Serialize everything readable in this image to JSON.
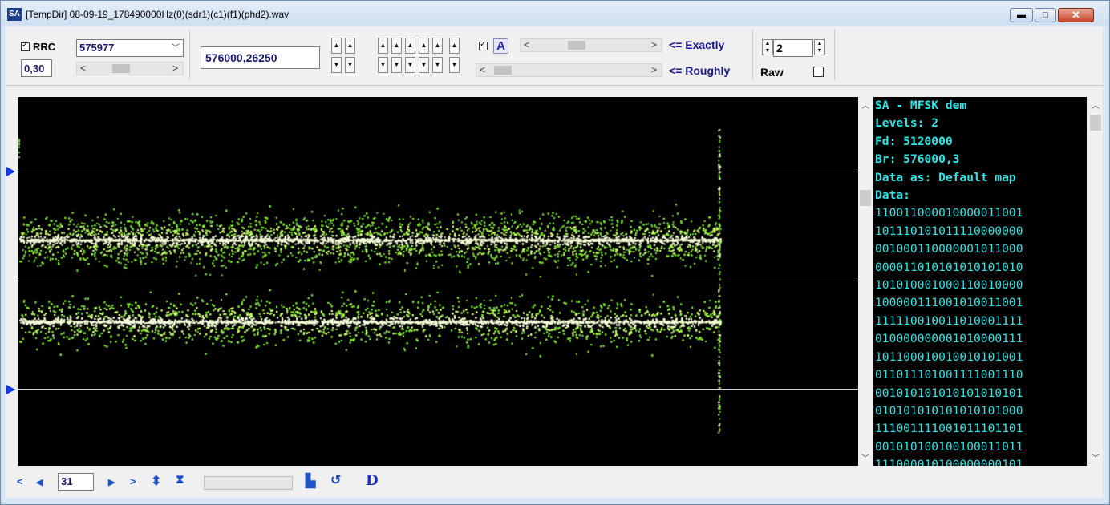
{
  "window": {
    "icon_text": "SA",
    "title": "[TempDir] 08-09-19_178490000Hz(0)(sdr1)(c1)(f1)(phd2).wav",
    "min_glyph": "▬",
    "max_glyph": "□",
    "close_glyph": "✕"
  },
  "toolbar": {
    "rrc_label": "RRC",
    "rrc_checked": true,
    "rolloff_value": "0,30",
    "rate_combo_value": "575977",
    "frequency_value": "576000,26250",
    "exactly_label": "<= Exactly",
    "roughly_label": "<= Roughly",
    "levels_value": "2",
    "raw_label": "Raw",
    "raw_checked": false,
    "auto_checked": true,
    "auto_button_label": "A",
    "scroll_left": "<",
    "scroll_right": ">",
    "spin_up": "▲",
    "spin_down": "▼"
  },
  "plot": {
    "trace_color": "#7fe62e",
    "core_color": "#f4ffd8",
    "marker_color": "#1438e0"
  },
  "text_panel": {
    "lines": [
      "SA - MFSK dem",
      "Levels: 2",
      "Fd: 5120000",
      "Br: 576000,3",
      "Data as: Default map",
      "Data:",
      "110011000010000011001",
      "101110101011110000000",
      "001000110000001011000",
      "000011010101010101010",
      "101010001000110010000",
      "100000111001010011001",
      "111110010011010001111",
      "010000000001010000111",
      "101100010010010101001",
      "011011101001111001110",
      "001010101010101010101",
      "010101010101010101000",
      "111001111001011101101",
      "001010100100100011011",
      "111000010100000000101"
    ],
    "text_color": "#2ee6e6"
  },
  "bottom": {
    "first_glyph": "<",
    "prev_glyph": "◀",
    "page_value": "31",
    "next_glyph": "▶",
    "last_glyph": ">",
    "updown_glyph": "⬍",
    "fit_glyph": "⧗",
    "save_glyph": "▙",
    "refresh_glyph": "↺",
    "d_label": "D"
  }
}
